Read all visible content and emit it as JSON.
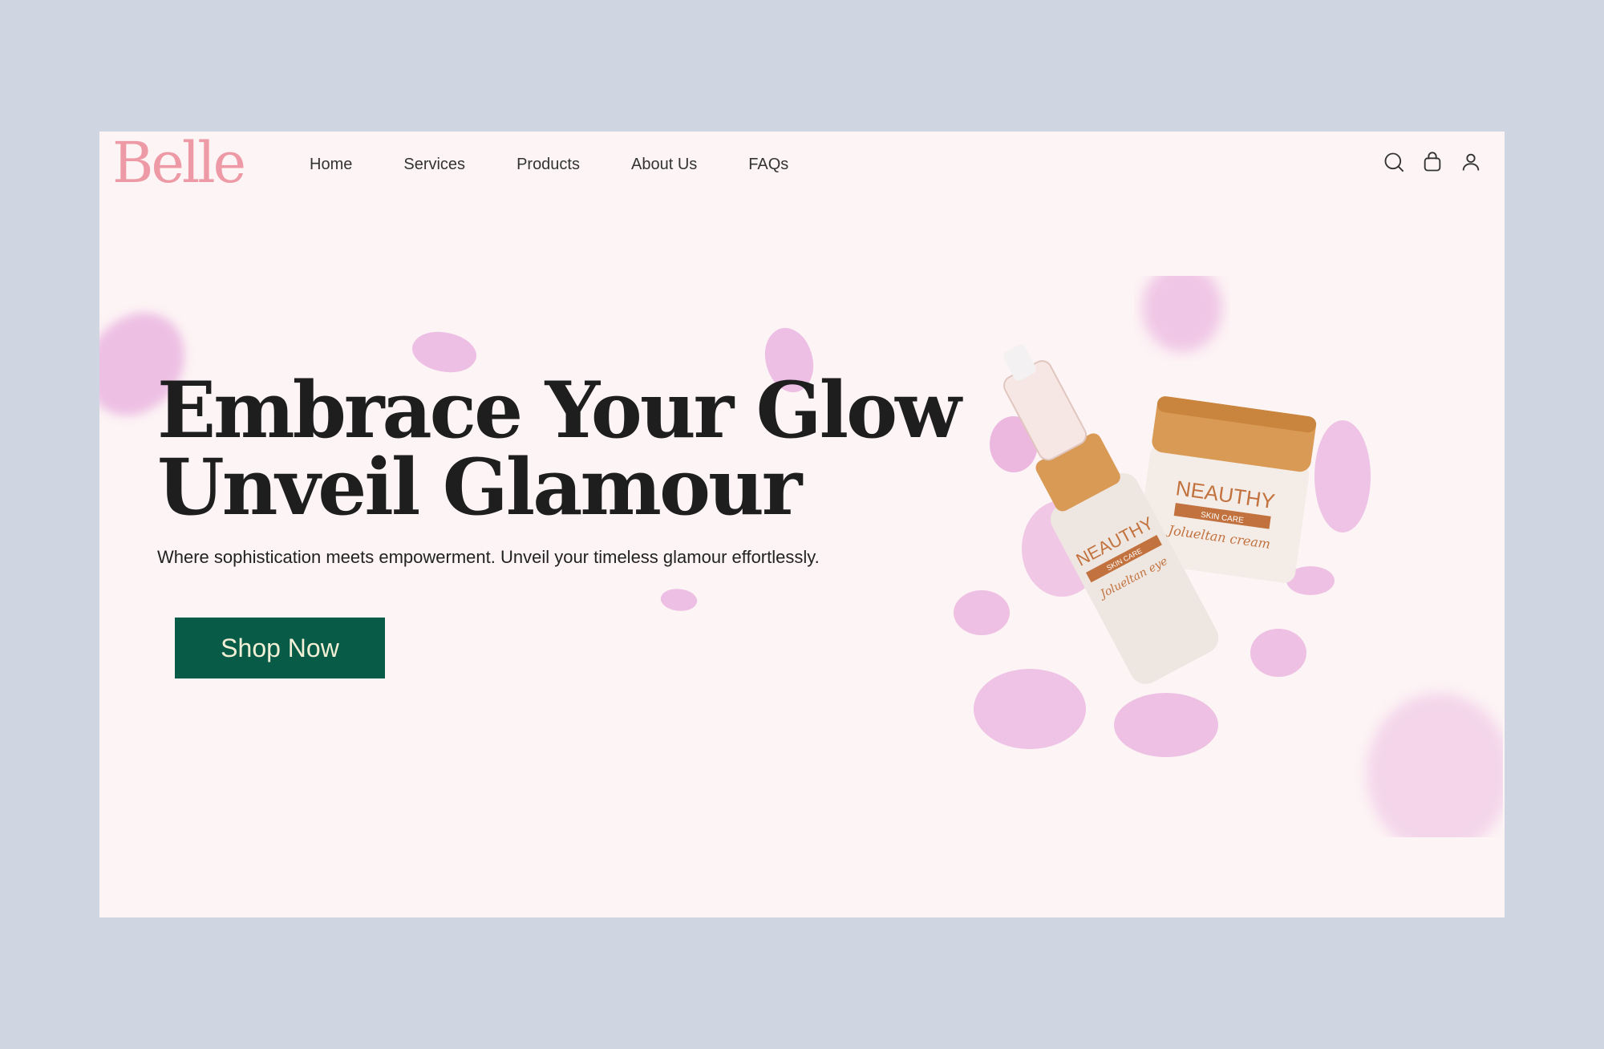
{
  "brand": {
    "logo": "Belle",
    "primary_color": "#ee9aa6",
    "accent_color": "#075b47"
  },
  "nav": {
    "items": [
      {
        "label": "Home"
      },
      {
        "label": "Services"
      },
      {
        "label": "Products"
      },
      {
        "label": "About Us"
      },
      {
        "label": "FAQs"
      }
    ],
    "icons": [
      "search-icon",
      "shopping-bag-icon",
      "user-icon"
    ]
  },
  "hero": {
    "headline_line1": "Embrace Your Glow",
    "headline_line2": "Unveil Glamour",
    "subtext": "Where sophistication meets empowerment. Unveil your timeless glamour effortlessly.",
    "cta_label": "Shop Now"
  },
  "products": {
    "serum": {
      "brand": "NEAUTHY",
      "tagline": "SKIN CARE",
      "name": "Jolueltan eye"
    },
    "cream": {
      "brand": "NEAUTHY",
      "tagline": "SKIN CARE",
      "name": "Jolueltan cream"
    }
  }
}
